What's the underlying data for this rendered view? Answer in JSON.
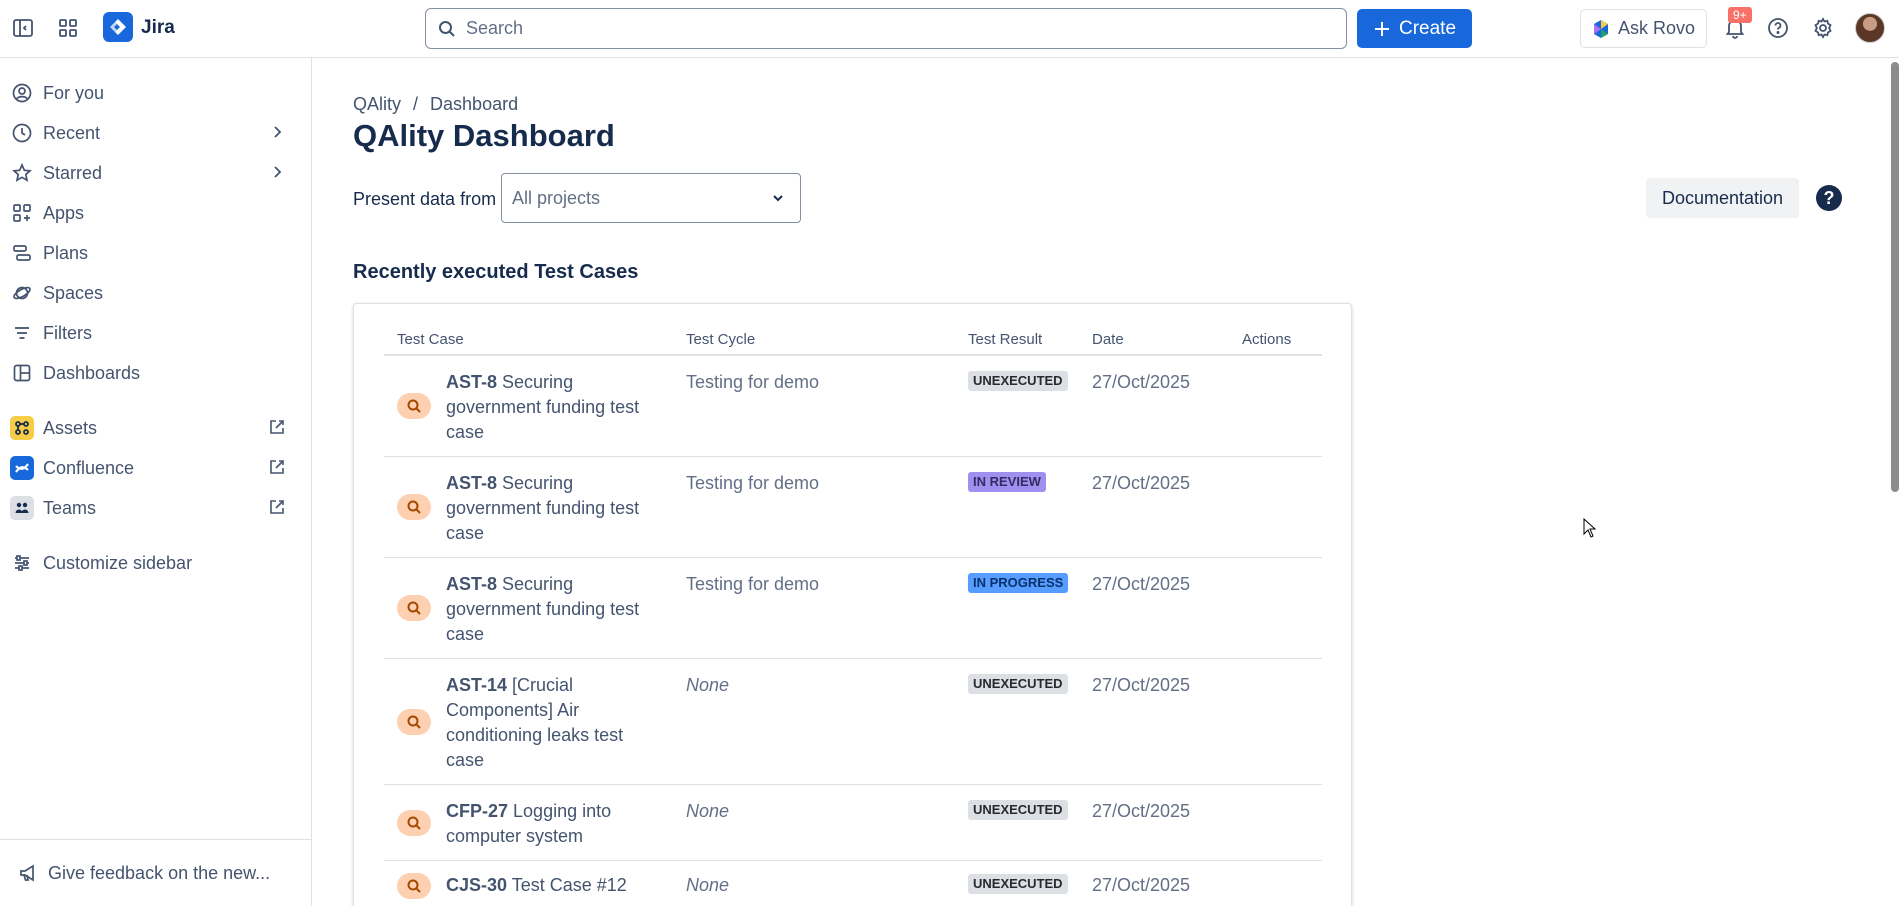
{
  "topbar": {
    "app_name": "Jira",
    "search_placeholder": "Search",
    "create_label": "Create",
    "ask_rovo_label": "Ask Rovo",
    "notification_badge": "9+"
  },
  "sidebar": {
    "items": [
      {
        "label": "For you",
        "icon": "user-circle-icon"
      },
      {
        "label": "Recent",
        "icon": "clock-icon"
      },
      {
        "label": "Starred",
        "icon": "star-icon"
      },
      {
        "label": "Apps",
        "icon": "apps-icon"
      },
      {
        "label": "Plans",
        "icon": "plans-icon"
      },
      {
        "label": "Spaces",
        "icon": "planet-icon"
      },
      {
        "label": "Filters",
        "icon": "filter-icon"
      },
      {
        "label": "Dashboards",
        "icon": "dashboard-icon"
      }
    ],
    "apps": [
      {
        "label": "Assets",
        "color": "#f5cd47"
      },
      {
        "label": "Confluence",
        "color": "#1868db"
      },
      {
        "label": "Teams",
        "color": "#dcdfe4"
      }
    ],
    "customize_label": "Customize sidebar",
    "feedback_label": "Give feedback on the new..."
  },
  "main": {
    "breadcrumb": {
      "root": "QAlity",
      "separator": "/",
      "current": "Dashboard"
    },
    "title": "QAlity Dashboard",
    "present_label": "Present data from",
    "project_select": "All projects",
    "documentation_label": "Documentation",
    "help_glyph": "?",
    "section_title": "Recently executed Test Cases",
    "table": {
      "headers": [
        "Test Case",
        "Test Cycle",
        "Test Result",
        "Date",
        "Actions"
      ],
      "rows": [
        {
          "key": "AST-8",
          "summary": "Securing government funding test case",
          "cycle": "Testing for demo",
          "result": "UNEXECUTED",
          "date": "27/Oct/2025"
        },
        {
          "key": "AST-8",
          "summary": "Securing government funding test case",
          "cycle": "Testing for demo",
          "result": "IN REVIEW",
          "date": "27/Oct/2025"
        },
        {
          "key": "AST-8",
          "summary": "Securing government funding test case",
          "cycle": "Testing for demo",
          "result": "IN PROGRESS",
          "date": "27/Oct/2025"
        },
        {
          "key": "AST-14",
          "summary": "[Crucial Components] Air conditioning leaks test case",
          "cycle": "None",
          "result": "UNEXECUTED",
          "date": "27/Oct/2025"
        },
        {
          "key": "CFP-27",
          "summary": "Logging into computer system",
          "cycle": "None",
          "result": "UNEXECUTED",
          "date": "27/Oct/2025"
        },
        {
          "key": "CJS-30",
          "summary": "Test Case #12",
          "cycle": "None",
          "result": "UNEXECUTED",
          "date": "27/Oct/2025"
        }
      ]
    }
  },
  "colors": {
    "accent": "#1868db",
    "unexecuted_bg": "#dcdfe4",
    "in_review_bg": "#9f8fef",
    "in_progress_bg": "#579dff"
  }
}
